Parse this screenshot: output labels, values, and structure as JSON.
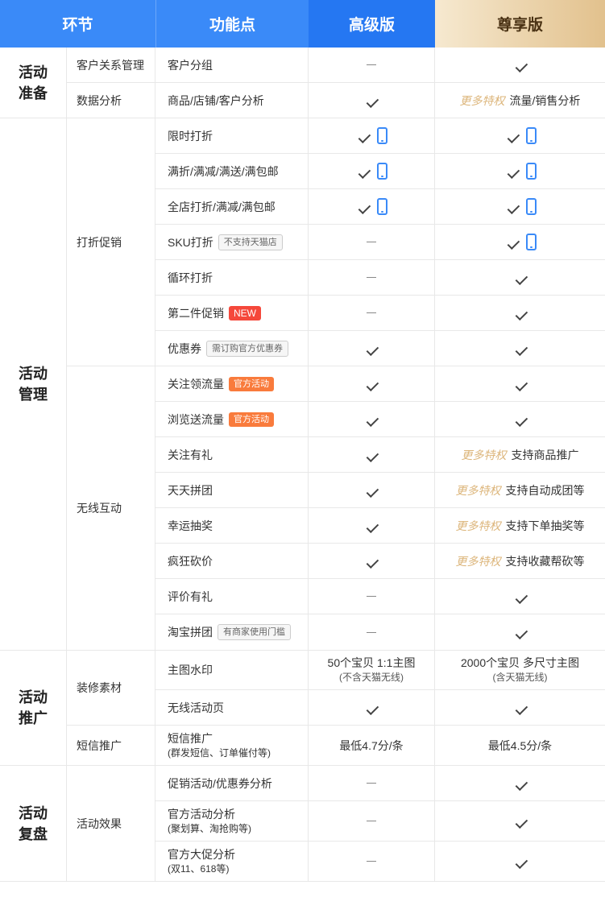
{
  "header": {
    "col1": "环节",
    "col2": "功能点",
    "col3": "高级版",
    "col4": "尊享版"
  },
  "stages": {
    "prep": [
      "活动",
      "准备"
    ],
    "manage": [
      "活动",
      "管理"
    ],
    "promote": [
      "活动",
      "推广"
    ],
    "review": [
      "活动",
      "复盘"
    ]
  },
  "subs": {
    "crm": "客户关系管理",
    "data": "数据分析",
    "discount": "打折促销",
    "wireless": "无线互动",
    "decor": "装修素材",
    "sms": "短信推广",
    "effect": "活动效果"
  },
  "features": {
    "f1": "客户分组",
    "f2": "商品/店铺/客户分析",
    "f3": "限时打折",
    "f4": "满折/满减/满送/满包邮",
    "f5": "全店打折/满减/满包邮",
    "f6": "SKU打折",
    "f6_badge": "不支持天猫店",
    "f7": "循环打折",
    "f8": "第二件促销",
    "f8_badge": "NEW",
    "f9": "优惠券",
    "f9_badge": "需订购官方优惠券",
    "f10": "关注领流量",
    "f10_badge": "官方活动",
    "f11": "浏览送流量",
    "f11_badge": "官方活动",
    "f12": "关注有礼",
    "f13": "天天拼团",
    "f14": "幸运抽奖",
    "f15": "疯狂砍价",
    "f16": "评价有礼",
    "f17": "淘宝拼团",
    "f17_badge": "有商家使用门槛",
    "f18": "主图水印",
    "f19": "无线活动页",
    "f20": "短信推广",
    "f20_note": "(群发短信、订单催付等)",
    "f21": "促销活动/优惠券分析",
    "f22": "官方活动分析",
    "f22_note": "(聚划算、淘抢购等)",
    "f23": "官方大促分析",
    "f23_note": "(双11、618等)"
  },
  "values": {
    "more": "更多特权",
    "v2_4": "流量/销售分析",
    "v12_4": "支持商品推广",
    "v13_4": "支持自动成团等",
    "v14_4": "支持下单抽奖等",
    "v15_4": "支持收藏帮砍等",
    "v18_3": "50个宝贝  1:1主图",
    "v18_3_note": "(不含天猫无线)",
    "v18_4": "2000个宝贝  多尺寸主图",
    "v18_4_note": "(含天猫无线)",
    "v20_3": "最低4.7分/条",
    "v20_4": "最低4.5分/条"
  },
  "colors": {
    "header_blue": "#3a8af8",
    "header_dark_blue": "#2577f2",
    "header_gold": "#e2c18d",
    "more_gold": "#dcb57a",
    "badge_red": "#f5483b",
    "badge_orange": "#f97b3c",
    "phone_blue": "#3a8af8"
  },
  "icons": {
    "check": "check-icon",
    "phone": "mobile-phone-icon",
    "dash": "dash-icon"
  }
}
